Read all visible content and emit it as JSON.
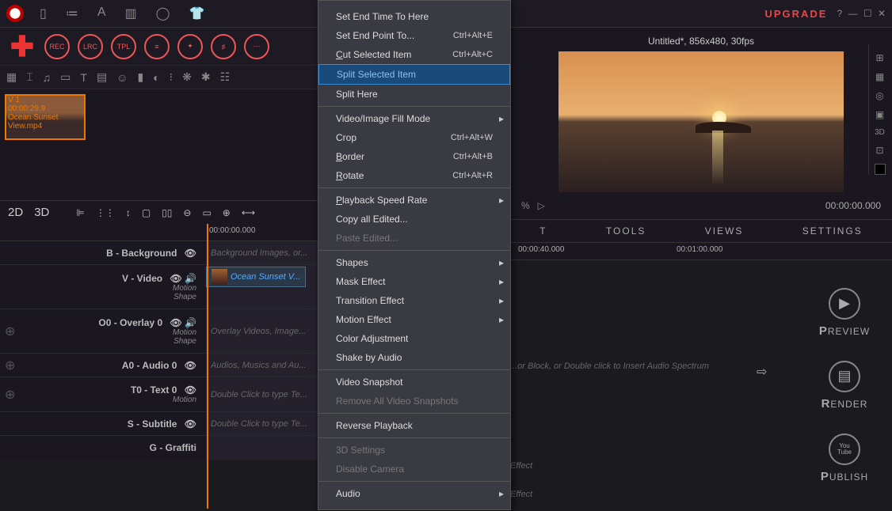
{
  "topbar": {
    "upgrade": "UPGRADE",
    "help": "?",
    "min": "—",
    "max": "☐",
    "close": "✕"
  },
  "tool_row1": {
    "rec": "REC",
    "lrc": "LRC",
    "tpl": "TPL"
  },
  "media": {
    "thumb": {
      "track": "V 1",
      "duration": "00:00:29.9",
      "name1": "Ocean Sunset",
      "name2": "View.mp4"
    }
  },
  "timeline_tabs": {
    "d2": "2D",
    "d3": "3D"
  },
  "ruler": {
    "t0": "00:00:00.000",
    "t40": "00:00:40.000",
    "t60": "00:01:00.000"
  },
  "tracks": {
    "bg": {
      "name": "B - Background",
      "hint": "Background Images, or..."
    },
    "v": {
      "name": "V - Video",
      "sub1": "Motion",
      "sub2": "Shape",
      "clip": "Ocean Sunset V..."
    },
    "o0": {
      "name": "O0 - Overlay 0",
      "sub1": "Motion",
      "sub2": "Shape",
      "hint": "Overlay Videos, Image...",
      "hint2": "...or Block, or Double click to Insert Audio Spectrum"
    },
    "a0": {
      "name": "A0 - Audio 0",
      "hint": "Audios, Musics and Au..."
    },
    "t0": {
      "name": "T0 - Text 0",
      "sub1": "Motion",
      "hint": "Double Click to type Te...",
      "hint2": "Effect"
    },
    "s": {
      "name": "S - Subtitle",
      "hint": "Double Click to type Te...",
      "hint2": "Effect"
    },
    "g": {
      "name": "G - Graffiti"
    }
  },
  "preview": {
    "title": "Untitled*, 856x480, 30fps",
    "volume": "%",
    "timecode": "00:00:00.000"
  },
  "tabs": {
    "t1": "T",
    "tools": "TOOLS",
    "views": "VIEWS",
    "settings": "SETTINGS"
  },
  "actions": {
    "preview": "REVIEW",
    "render": "ENDER",
    "publish": "UBLISH",
    "yt1": "You",
    "yt2": "Tube"
  },
  "context_menu": [
    {
      "label": "Set End Time To Here",
      "type": "item"
    },
    {
      "label": "Set End Point To...",
      "shortcut": "Ctrl+Alt+E",
      "type": "item"
    },
    {
      "label": "Cut Selected Item",
      "shortcut": "Ctrl+Alt+C",
      "type": "item",
      "u": "C"
    },
    {
      "label": "Split Selected Item",
      "type": "highlight"
    },
    {
      "label": "Split Here",
      "type": "item"
    },
    {
      "type": "sep"
    },
    {
      "label": "Video/Image Fill Mode",
      "type": "submenu"
    },
    {
      "label": "Crop",
      "shortcut": "Ctrl+Alt+W",
      "type": "item"
    },
    {
      "label": "Border",
      "shortcut": "Ctrl+Alt+B",
      "type": "item",
      "u": "B"
    },
    {
      "label": "Rotate",
      "shortcut": "Ctrl+Alt+R",
      "type": "item",
      "u": "R"
    },
    {
      "type": "sep"
    },
    {
      "label": "Playback Speed Rate",
      "type": "submenu",
      "u": "P"
    },
    {
      "label": "Copy all Edited...",
      "type": "item"
    },
    {
      "label": "Paste Edited...",
      "type": "disabled"
    },
    {
      "type": "sep"
    },
    {
      "label": "Shapes",
      "type": "submenu"
    },
    {
      "label": "Mask Effect",
      "type": "submenu"
    },
    {
      "label": "Transition Effect",
      "type": "submenu"
    },
    {
      "label": "Motion Effect",
      "type": "submenu"
    },
    {
      "label": "Color Adjustment",
      "type": "item"
    },
    {
      "label": "Shake by Audio",
      "type": "item"
    },
    {
      "type": "sep"
    },
    {
      "label": "Video Snapshot",
      "type": "item"
    },
    {
      "label": "Remove All Video Snapshots",
      "type": "disabled"
    },
    {
      "type": "sep"
    },
    {
      "label": "Reverse Playback",
      "type": "item"
    },
    {
      "type": "sep"
    },
    {
      "label": "3D Settings",
      "type": "disabled"
    },
    {
      "label": "Disable Camera",
      "type": "disabled"
    },
    {
      "type": "sep"
    },
    {
      "label": "Audio",
      "type": "submenu"
    }
  ]
}
